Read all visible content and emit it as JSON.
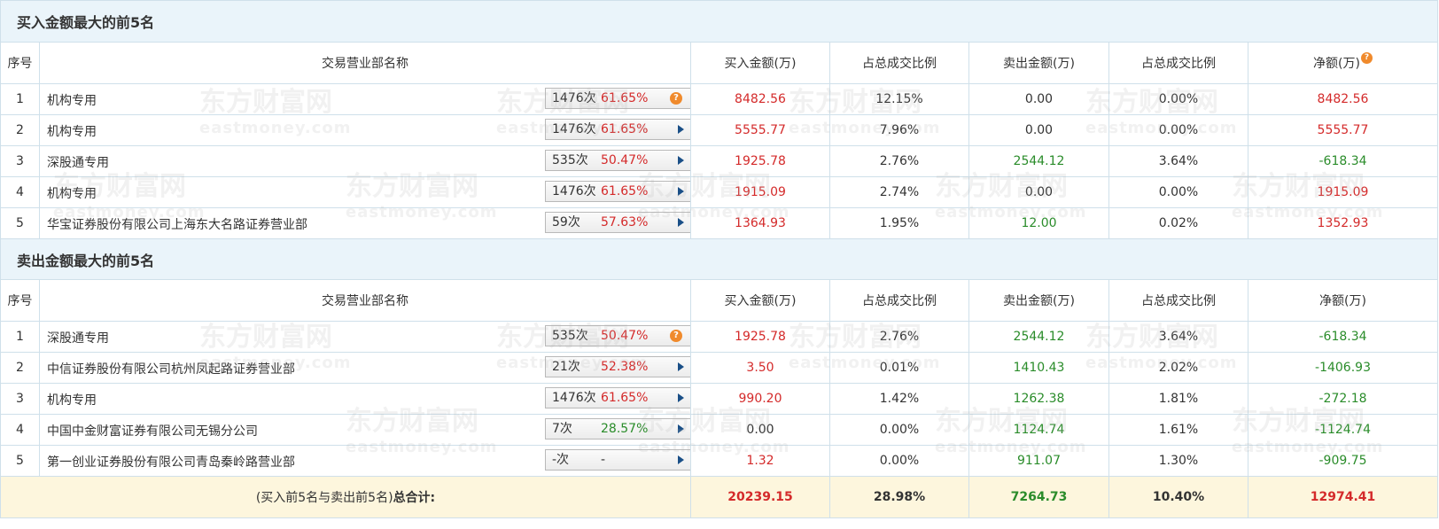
{
  "buy_section": {
    "title": "买入金额最大的前5名",
    "headers": {
      "idx": "序号",
      "name": "交易营业部名称",
      "buy": "买入金额(万)",
      "buy_pct": "占总成交比例",
      "sell": "卖出金额(万)",
      "sell_pct": "占总成交比例",
      "net": "净额(万)"
    },
    "rows": [
      {
        "idx": "1",
        "name": "机构专用",
        "times": "1476次",
        "rate": "61.65%",
        "buy": "8482.56",
        "buy_pct": "12.15%",
        "sell": "0.00",
        "sell_pct": "0.00%",
        "net": "8482.56"
      },
      {
        "idx": "2",
        "name": "机构专用",
        "times": "1476次",
        "rate": "61.65%",
        "buy": "5555.77",
        "buy_pct": "7.96%",
        "sell": "0.00",
        "sell_pct": "0.00%",
        "net": "5555.77"
      },
      {
        "idx": "3",
        "name": "深股通专用",
        "times": "535次",
        "rate": "50.47%",
        "buy": "1925.78",
        "buy_pct": "2.76%",
        "sell": "2544.12",
        "sell_pct": "3.64%",
        "net": "-618.34"
      },
      {
        "idx": "4",
        "name": "机构专用",
        "times": "1476次",
        "rate": "61.65%",
        "buy": "1915.09",
        "buy_pct": "2.74%",
        "sell": "0.00",
        "sell_pct": "0.00%",
        "net": "1915.09"
      },
      {
        "idx": "5",
        "name": "华宝证券股份有限公司上海东大名路证券营业部",
        "times": "59次",
        "rate": "57.63%",
        "buy": "1364.93",
        "buy_pct": "1.95%",
        "sell": "12.00",
        "sell_pct": "0.02%",
        "net": "1352.93"
      }
    ]
  },
  "sell_section": {
    "title": "卖出金额最大的前5名",
    "headers": {
      "idx": "序号",
      "name": "交易营业部名称",
      "buy": "买入金额(万)",
      "buy_pct": "占总成交比例",
      "sell": "卖出金额(万)",
      "sell_pct": "占总成交比例",
      "net": "净额(万)"
    },
    "rows": [
      {
        "idx": "1",
        "name": "深股通专用",
        "times": "535次",
        "rate": "50.47%",
        "buy": "1925.78",
        "buy_pct": "2.76%",
        "sell": "2544.12",
        "sell_pct": "3.64%",
        "net": "-618.34"
      },
      {
        "idx": "2",
        "name": "中信证券股份有限公司杭州凤起路证券营业部",
        "times": "21次",
        "rate": "52.38%",
        "buy": "3.50",
        "buy_pct": "0.01%",
        "sell": "1410.43",
        "sell_pct": "2.02%",
        "net": "-1406.93"
      },
      {
        "idx": "3",
        "name": "机构专用",
        "times": "1476次",
        "rate": "61.65%",
        "buy": "990.20",
        "buy_pct": "1.42%",
        "sell": "1262.38",
        "sell_pct": "1.81%",
        "net": "-272.18"
      },
      {
        "idx": "4",
        "name": "中国中金财富证券有限公司无锡分公司",
        "times": "7次",
        "rate": "28.57%",
        "buy": "0.00",
        "buy_pct": "0.00%",
        "sell": "1124.74",
        "sell_pct": "1.61%",
        "net": "-1124.74"
      },
      {
        "idx": "5",
        "name": "第一创业证券股份有限公司青岛秦岭路营业部",
        "times": "-次",
        "rate": "-",
        "buy": "1.32",
        "buy_pct": "0.00%",
        "sell": "911.07",
        "sell_pct": "1.30%",
        "net": "-909.75"
      }
    ]
  },
  "total": {
    "label_prefix": "(买入前5名与卖出前5名)",
    "label_bold": "总合计:",
    "buy": "20239.15",
    "buy_pct": "28.98%",
    "sell": "7264.73",
    "sell_pct": "10.40%",
    "net": "12974.41"
  },
  "watermark": {
    "cn": "东方财富网",
    "en": "eastmoney.com"
  },
  "colors": {
    "red": "#d42a2a",
    "green": "#2a8c2a",
    "header_bg": "#eaf4fa",
    "total_bg": "#fdf6dd"
  }
}
